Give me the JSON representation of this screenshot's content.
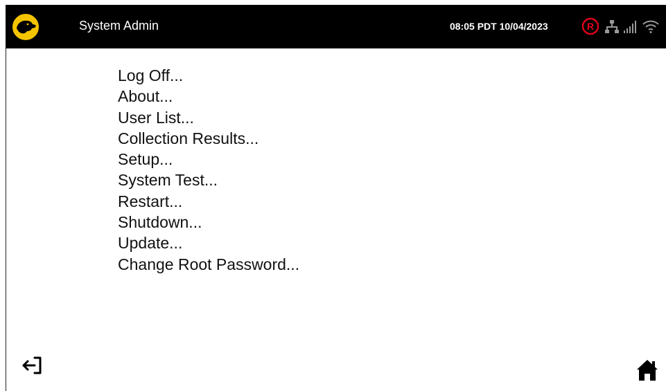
{
  "header": {
    "title": "System Admin",
    "datetime": "08:05 PDT  10/04/2023",
    "logo_icon": "dog-logo-icon",
    "status_icons": [
      "registered-icon",
      "network-icon",
      "signal-icon",
      "wifi-icon"
    ],
    "colors": {
      "bar": "#000000",
      "logo": "#f5c400",
      "registered": "#e0001b",
      "status": "#9a9a9a"
    }
  },
  "menu": {
    "items": [
      {
        "label": "Log Off..."
      },
      {
        "label": "About..."
      },
      {
        "label": "User List..."
      },
      {
        "label": "Collection Results..."
      },
      {
        "label": "Setup..."
      },
      {
        "label": "System Test..."
      },
      {
        "label": "Restart..."
      },
      {
        "label": "Shutdown..."
      },
      {
        "label": "Update..."
      },
      {
        "label": "Change Root Password..."
      }
    ]
  },
  "footer": {
    "exit_icon": "exit-icon",
    "home_icon": "home-icon"
  }
}
